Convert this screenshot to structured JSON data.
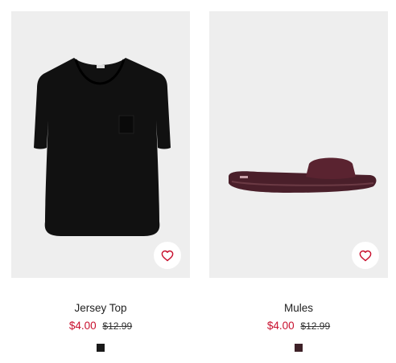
{
  "products": [
    {
      "title": "Jersey Top",
      "sale_price": "$4.00",
      "original_price": "$12.99",
      "swatch_color": "#1a1a1a",
      "favorite_icon": "heart-outline-icon"
    },
    {
      "title": "Mules",
      "sale_price": "$4.00",
      "original_price": "$12.99",
      "swatch_color": "#3e2128",
      "favorite_icon": "heart-outline-icon"
    }
  ],
  "colors": {
    "accent_sale": "#c8102e",
    "image_background": "#eeeeee",
    "heart": "#c8102e"
  }
}
